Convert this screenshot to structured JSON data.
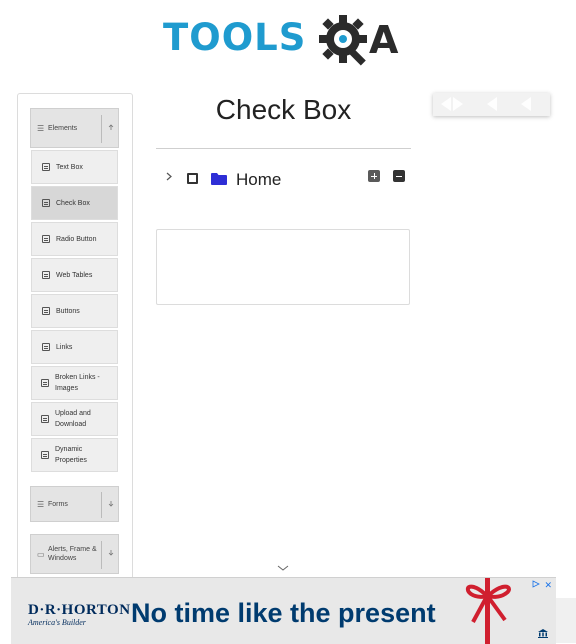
{
  "header": {
    "logo_text": "TOOLS",
    "logo_tail": "A",
    "logo_icon": "gear-q-icon"
  },
  "sidebar": {
    "groups": [
      {
        "label": "Elements",
        "icon": "list-icon",
        "arrow": "chevron-up-icon"
      },
      {
        "label": "Forms",
        "icon": "list-icon",
        "arrow": "chevron-down-icon"
      },
      {
        "label": "Alerts, Frame & Windows",
        "icon": "window-icon",
        "arrow": "chevron-down-icon"
      }
    ],
    "items": [
      {
        "label": "Text Box",
        "icon": "html5-icon"
      },
      {
        "label": "Check Box",
        "icon": "html5-icon",
        "active": true
      },
      {
        "label": "Radio Button",
        "icon": "html5-icon"
      },
      {
        "label": "Web Tables",
        "icon": "html5-icon"
      },
      {
        "label": "Buttons",
        "icon": "html5-icon"
      },
      {
        "label": "Links",
        "icon": "html5-icon"
      },
      {
        "label": "Broken Links - Images",
        "icon": "html5-icon"
      },
      {
        "label": "Upload and Download",
        "icon": "html5-icon"
      },
      {
        "label": "Dynamic Properties",
        "icon": "html5-icon"
      }
    ]
  },
  "main": {
    "title": "Check Box",
    "tree": {
      "root_label": "Home",
      "expand_all_icon": "plus-square-icon",
      "collapse_all_icon": "minus-square-icon",
      "checked": false,
      "expanded": false
    }
  },
  "ad": {
    "brand": "D·R·HORTON",
    "brand_tagline": "America's Builder",
    "headline": "No time like the present",
    "close_glyph": "✕"
  },
  "colors": {
    "logo_blue": "#1f9bcf",
    "logo_dark": "#2b2b2b",
    "folder": "#2e2ed6",
    "ad_navy": "#003b6f",
    "ribbon_red": "#d01f2f"
  }
}
